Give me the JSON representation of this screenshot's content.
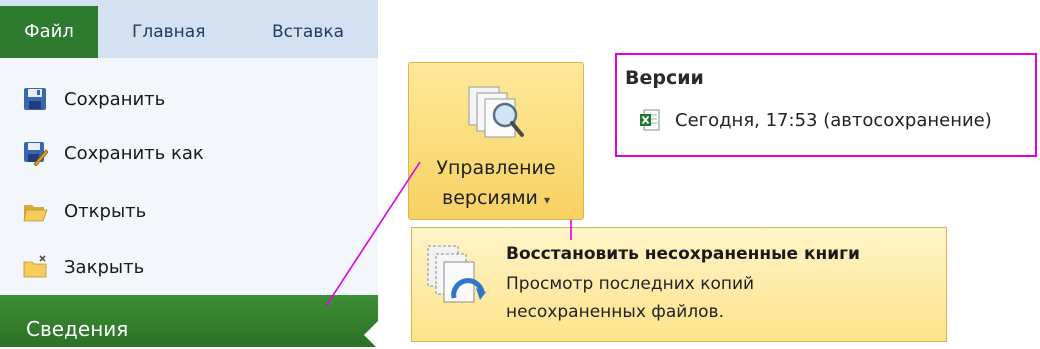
{
  "tabs": {
    "file": "Файл",
    "home": "Главная",
    "insert": "Вставка"
  },
  "menu": {
    "items": [
      {
        "label": "Сохранить",
        "icon": "save-icon"
      },
      {
        "label": "Сохранить как",
        "icon": "save-as-icon"
      },
      {
        "label": "Открыть",
        "icon": "open-folder-icon"
      },
      {
        "label": "Закрыть",
        "icon": "close-folder-icon"
      }
    ],
    "selected": "Сведения"
  },
  "manage_versions": {
    "line1": "Управление",
    "line2": "версиями",
    "arrow": "▾"
  },
  "versions": {
    "title": "Версии",
    "entry": "Сегодня, 17:53 (автосохранение)"
  },
  "recover": {
    "title": "Восстановить несохраненные книги",
    "desc_line1": "Просмотр последних копий",
    "desc_line2": "несохраненных файлов."
  },
  "colors": {
    "file_tab": "#2e7a2e",
    "ribbon_tabs_bg": "#d3e1f1",
    "panel_bg": "#f3f6fa",
    "highlight_gold": "#f8d163",
    "annotation_magenta": "#e000e0"
  }
}
